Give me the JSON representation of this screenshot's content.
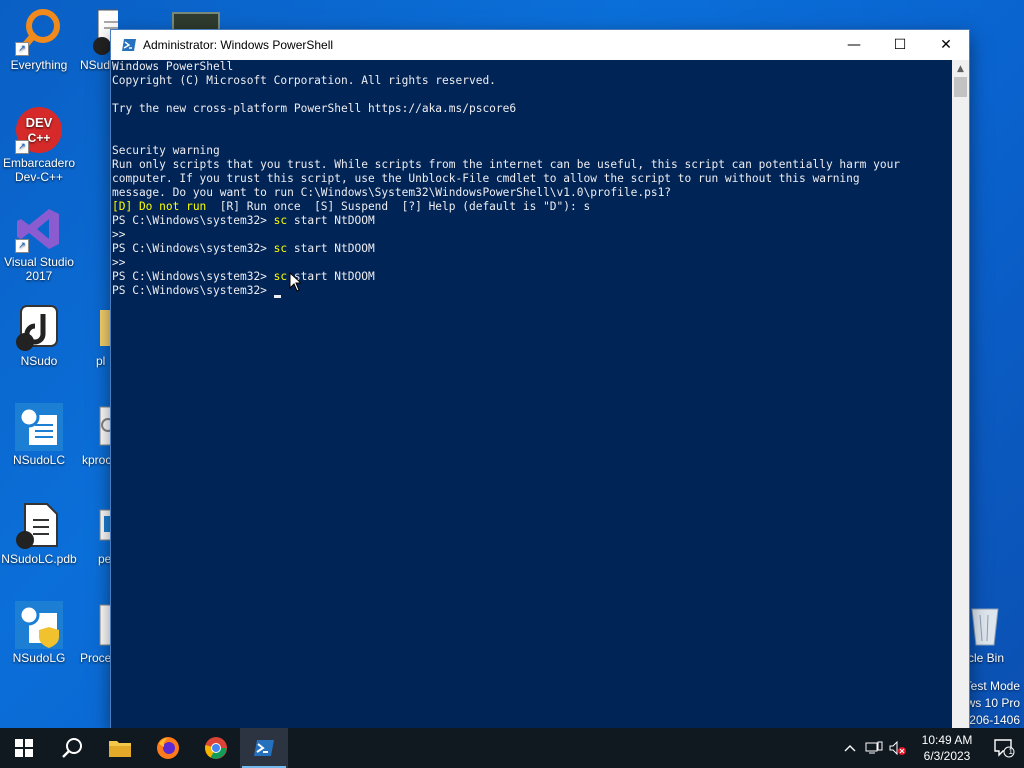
{
  "desktop": {
    "icons": [
      {
        "label": "Everything"
      },
      {
        "label": "NSudo"
      },
      {
        "label": "Embarcadero Dev-C++"
      },
      {
        "label": "Visual Studio 2017"
      },
      {
        "label": "NSudo"
      },
      {
        "label": "pl"
      },
      {
        "label": "NSudoLC"
      },
      {
        "label": "kproc"
      },
      {
        "label": "NSudoLC.pdb"
      },
      {
        "label": "pe"
      },
      {
        "label": "NSudoLG"
      },
      {
        "label": "Proce"
      },
      {
        "label": "cle Bin"
      }
    ],
    "watermark": {
      "line1": "Test Mode",
      "line2": "ws 10 Pro",
      "line3": "206-1406"
    }
  },
  "window": {
    "title": "Administrator: Windows PowerShell",
    "minimize": "—",
    "maximize": "☐",
    "close": "✕",
    "console": {
      "l01": "Windows PowerShell",
      "l02": "Copyright (C) Microsoft Corporation. All rights reserved.",
      "l03": "",
      "l04": "Try the new cross-platform PowerShell https://aka.ms/pscore6",
      "l05": "",
      "l06": "",
      "l07": "Security warning",
      "l08": "Run only scripts that you trust. While scripts from the internet can be useful, this script can potentially harm your",
      "l09": "computer. If you trust this script, use the Unblock-File cmdlet to allow the script to run without this warning",
      "l10": "message. Do you want to run C:\\Windows\\System32\\WindowsPowerShell\\v1.0\\profile.ps1?",
      "l11_choice_default": "[D] Do not run",
      "l11_rest": "  [R] Run once  [S] Suspend  [?] Help (default is \"D\"): s",
      "prompt": "PS C:\\Windows\\system32> ",
      "cmd_keyword": "sc",
      "cmd_args": " start NtDOOM",
      "continuation": ">>"
    }
  },
  "taskbar": {
    "clock_time": "10:49 AM",
    "clock_date": "6/3/2023",
    "notification_count": "1"
  },
  "colors": {
    "console_bg": "#012456",
    "console_fg": "#eeedf0",
    "console_yellow": "#ffff00",
    "desktop_blue": "#0b6fd9"
  }
}
